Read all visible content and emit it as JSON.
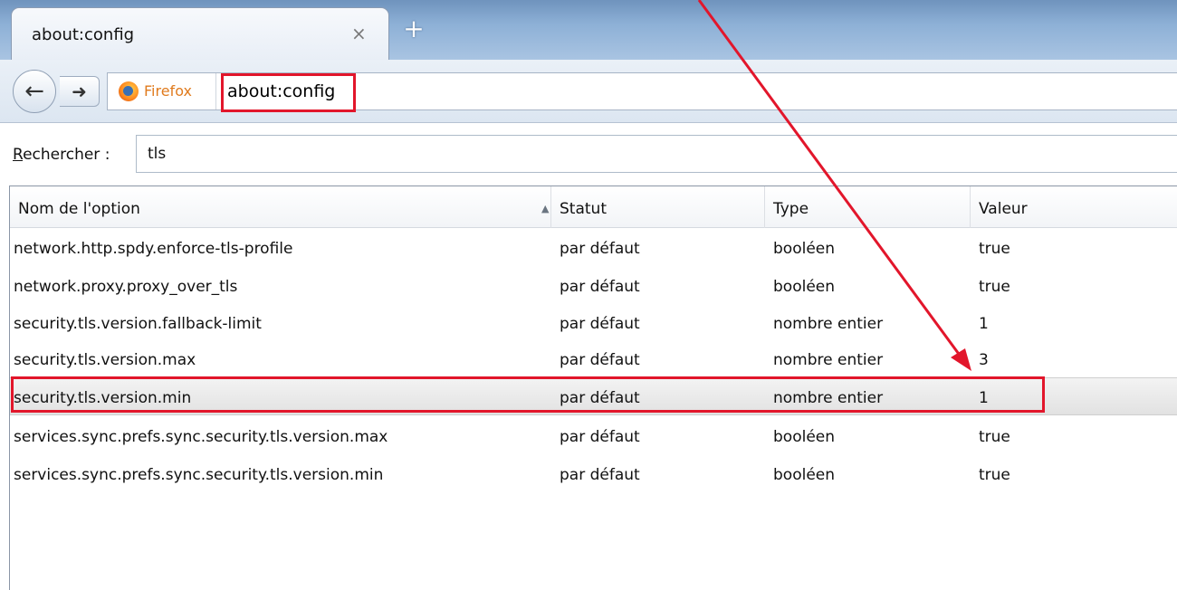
{
  "browser": {
    "tab": {
      "title": "about:config",
      "close_glyph": "×"
    },
    "new_tab_glyph": "+",
    "nav": {
      "back_glyph": "←",
      "forward_glyph": "➜"
    },
    "identity_label": "Firefox",
    "url": "about:config"
  },
  "search": {
    "label_accel": "R",
    "label_rest": "echercher :",
    "value": "tls"
  },
  "table": {
    "columns": [
      "Nom de l'option",
      "Statut",
      "Type",
      "Valeur"
    ],
    "sort_indicator": "▲",
    "rows": [
      {
        "name": "network.http.spdy.enforce-tls-profile",
        "status": "par défaut",
        "type": "booléen",
        "value": "true"
      },
      {
        "name": "network.proxy.proxy_over_tls",
        "status": "par défaut",
        "type": "booléen",
        "value": "true"
      },
      {
        "name": "security.tls.version.fallback-limit",
        "status": "par défaut",
        "type": "nombre entier",
        "value": "1"
      },
      {
        "name": "security.tls.version.max",
        "status": "par défaut",
        "type": "nombre entier",
        "value": "3"
      },
      {
        "name": "security.tls.version.min",
        "status": "par défaut",
        "type": "nombre entier",
        "value": "1"
      },
      {
        "name": "services.sync.prefs.sync.security.tls.version.max",
        "status": "par défaut",
        "type": "booléen",
        "value": "true"
      },
      {
        "name": "services.sync.prefs.sync.security.tls.version.min",
        "status": "par défaut",
        "type": "booléen",
        "value": "true"
      }
    ],
    "selected_row": 4
  },
  "annotation_color": "#e2162b"
}
